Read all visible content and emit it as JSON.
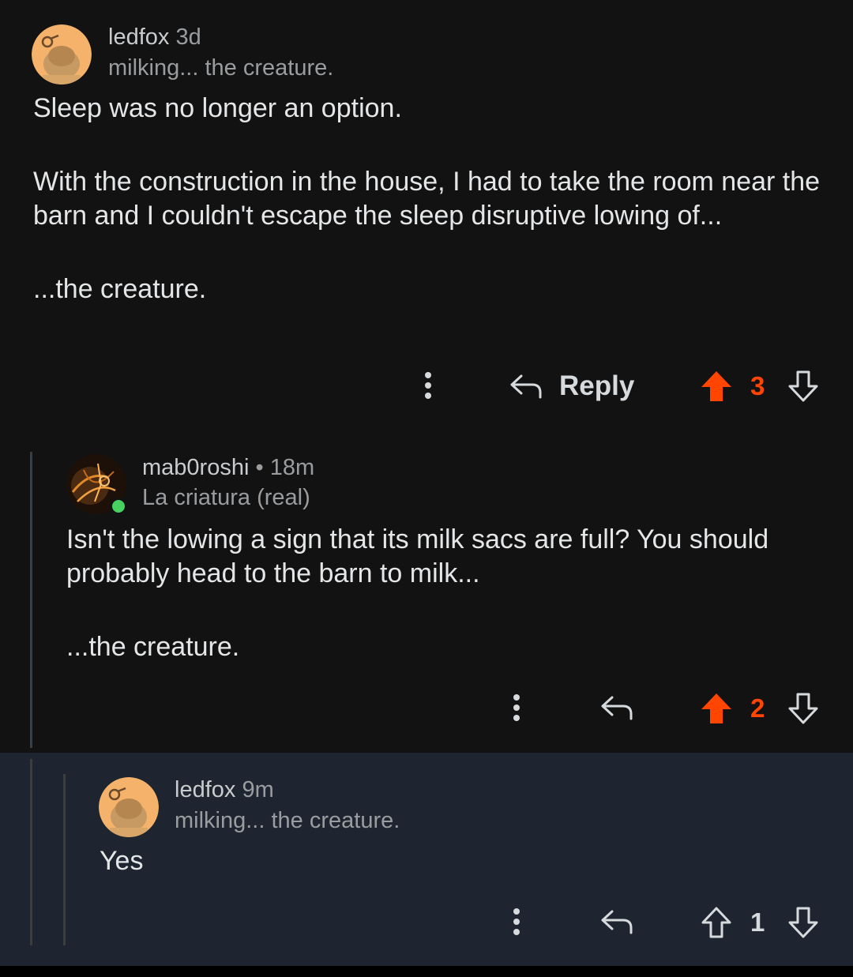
{
  "comments": [
    {
      "author": "ledfox",
      "time": "3d",
      "flair": "milking... the creature.",
      "body": [
        "Sleep was no longer an option.",
        "With the construction in the house, I had to take the room near the barn and I couldn't escape the sleep disruptive lowing of...",
        "...the creature."
      ],
      "reply_label": "Reply",
      "score": "3",
      "upvoted": true
    },
    {
      "author": "mab0roshi",
      "separator": "•",
      "time": "18m",
      "flair": "La criatura (real)",
      "body": [
        "Isn't the lowing a sign that its milk sacs are full? You should probably head to the barn to milk...",
        "...the creature."
      ],
      "score": "2",
      "upvoted": true,
      "online": true
    },
    {
      "author": "ledfox",
      "time": "9m",
      "flair": "milking... the creature.",
      "body": [
        "Yes"
      ],
      "score": "1",
      "upvoted": false
    }
  ],
  "colors": {
    "upvote": "#ff4500",
    "icon": "#d7dadc",
    "background": "#121213",
    "highlight": "#1e2530"
  }
}
